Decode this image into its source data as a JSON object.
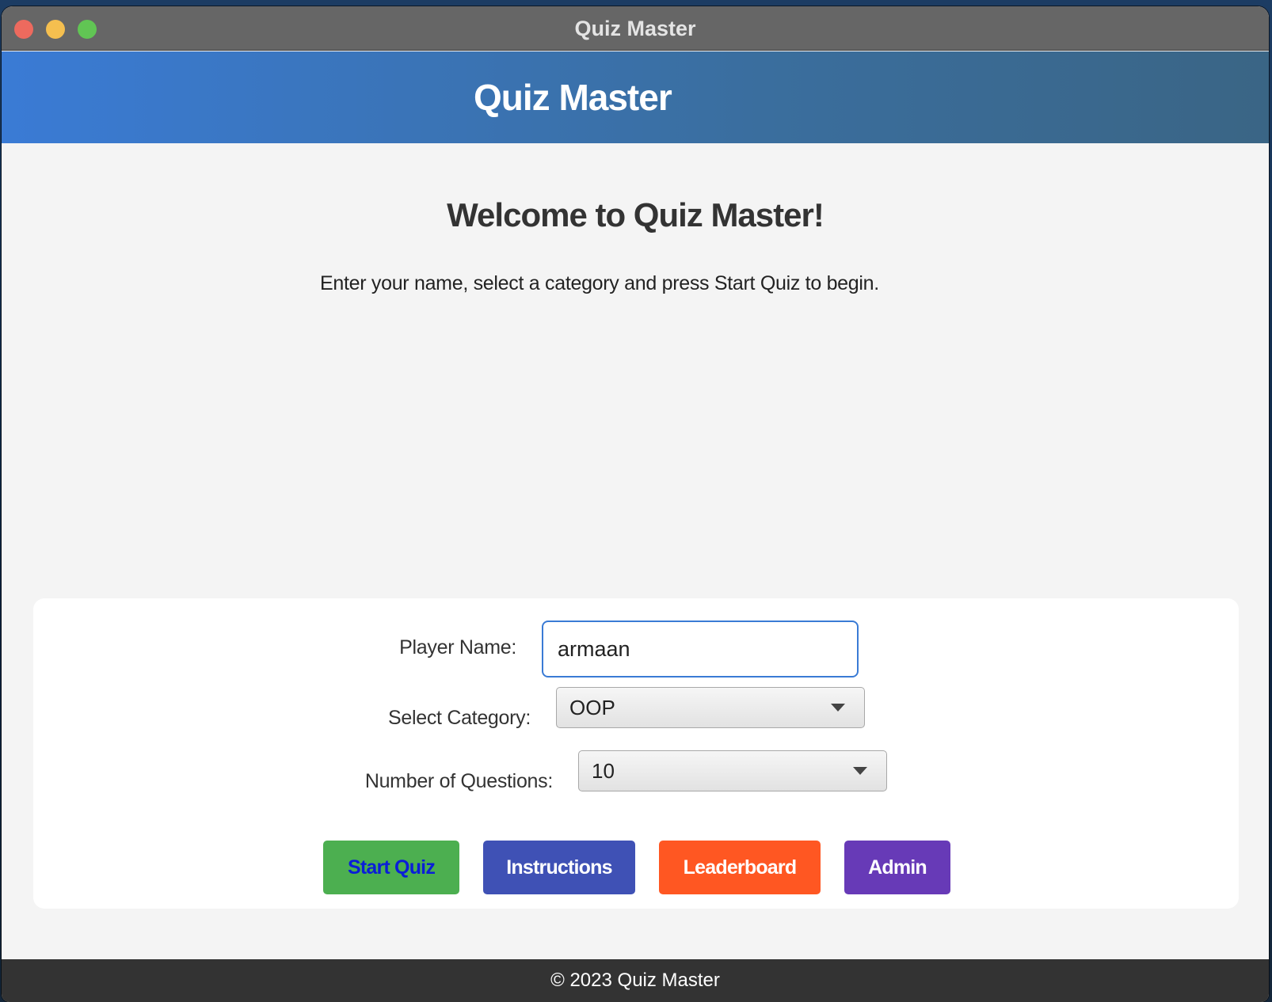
{
  "window": {
    "title": "Quiz Master"
  },
  "header": {
    "title": "Quiz Master"
  },
  "main": {
    "welcome": "Welcome to Quiz Master!",
    "subtitle": "Enter your name, select a category and press Start Quiz to begin."
  },
  "form": {
    "player_name_label": "Player Name:",
    "player_name_value": "armaan",
    "category_label": "Select Category:",
    "category_value": "OOP",
    "questions_label": "Number of Questions:",
    "questions_value": "10"
  },
  "buttons": {
    "start": "Start Quiz",
    "instructions": "Instructions",
    "leaderboard": "Leaderboard",
    "admin": "Admin"
  },
  "footer": {
    "text": "© 2023 Quiz Master"
  },
  "colors": {
    "header_start": "#3a7bd5",
    "start_button": "#4caf50",
    "instructions_button": "#3f51b5",
    "leaderboard_button": "#ff5722",
    "admin_button": "#673ab7",
    "footer_bg": "#333333"
  }
}
